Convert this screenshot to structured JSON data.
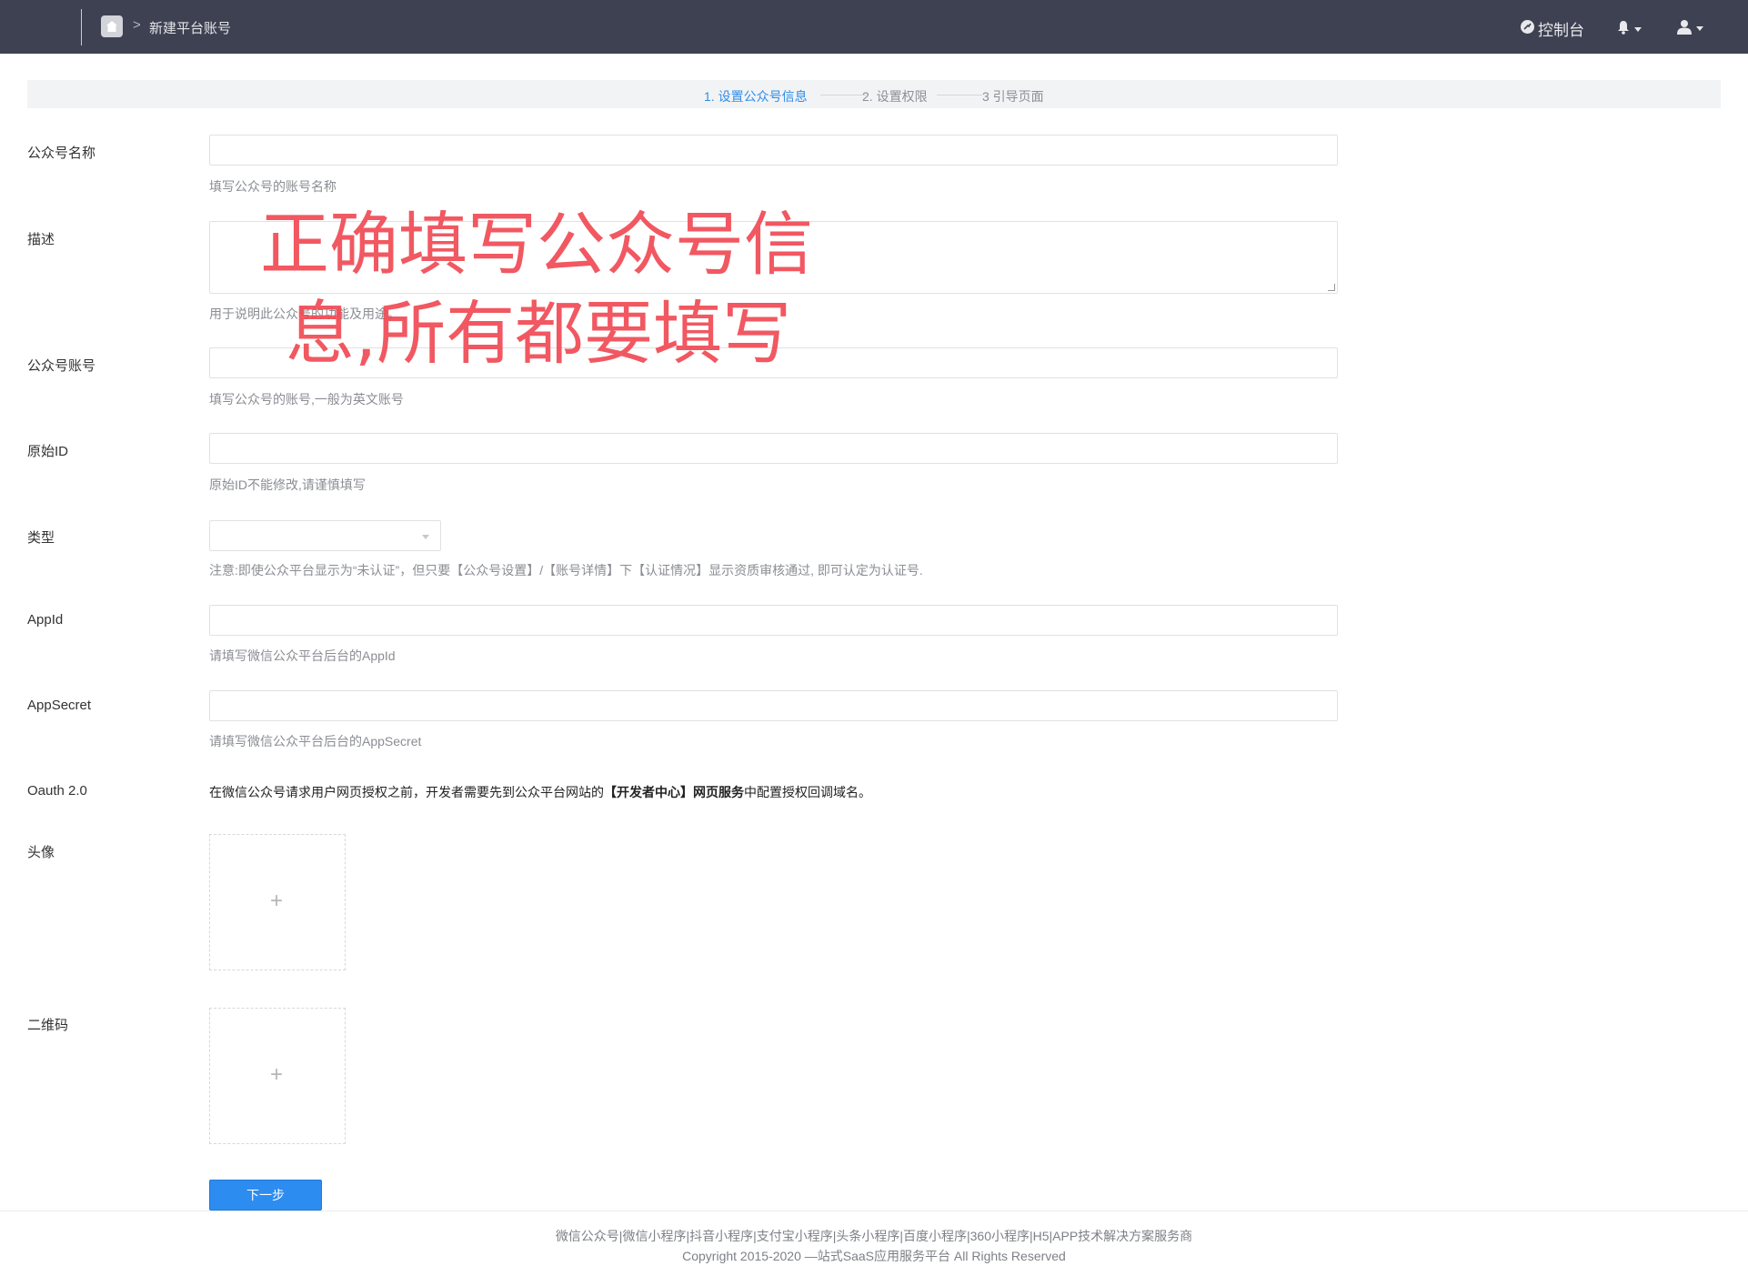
{
  "header": {
    "breadcrumb_current": "新建平台账号",
    "breadcrumb_separator": ">",
    "console_label": "控制台",
    "home_icon": "home-icon",
    "bell_icon": "bell-icon",
    "user_icon": "user-icon"
  },
  "steps": [
    {
      "label": "1. 设置公众号信息",
      "active": true
    },
    {
      "label": "2. 设置权限",
      "active": false
    },
    {
      "label": "3 引导页面",
      "active": false
    }
  ],
  "form": {
    "name": {
      "label": "公众号名称",
      "value": "",
      "help": "填写公众号的账号名称"
    },
    "description": {
      "label": "描述",
      "value": "",
      "help": "用于说明此公众号的功能及用途。"
    },
    "account": {
      "label": "公众号账号",
      "value": "",
      "help": "填写公众号的账号,一般为英文账号"
    },
    "original_id": {
      "label": "原始ID",
      "value": "",
      "help": "原始ID不能修改,请谨慎填写"
    },
    "type": {
      "label": "类型",
      "value": "",
      "help": "注意:即使公众平台显示为“未认证”，但只要【公众号设置】/【账号详情】下【认证情况】显示资质审核通过, 即可认定为认证号."
    },
    "appid": {
      "label": "AppId",
      "value": "",
      "help": "请填写微信公众平台后台的AppId"
    },
    "appsecret": {
      "label": "AppSecret",
      "value": "",
      "help": "请填写微信公众平台后台的AppSecret"
    },
    "oauth": {
      "label": "Oauth 2.0",
      "text_before": "在微信公众号请求用户网页授权之前，开发者需要先到公众平台网站的",
      "text_bold": "【开发者中心】网页服务",
      "text_after": "中配置授权回调域名。"
    },
    "avatar": {
      "label": "头像",
      "upload_symbol": "+"
    },
    "qrcode": {
      "label": "二维码",
      "upload_symbol": "+"
    },
    "next_button": "下一步"
  },
  "overlay": {
    "line1": "正确填写公众号信",
    "line2": "息,所有都要填写"
  },
  "footer": {
    "links": "微信公众号|微信小程序|抖音小程序|支付宝小程序|头条小程序|百度小程序|360小程序|H5|APP技术解决方案服务商",
    "copyright": "Copyright 2015-2020 —站式SaaS应用服务平台 All Rights Reserved"
  },
  "colors": {
    "topbar": "#3d4152",
    "accent": "#2d8cf0",
    "overlay_text": "#f04650"
  }
}
